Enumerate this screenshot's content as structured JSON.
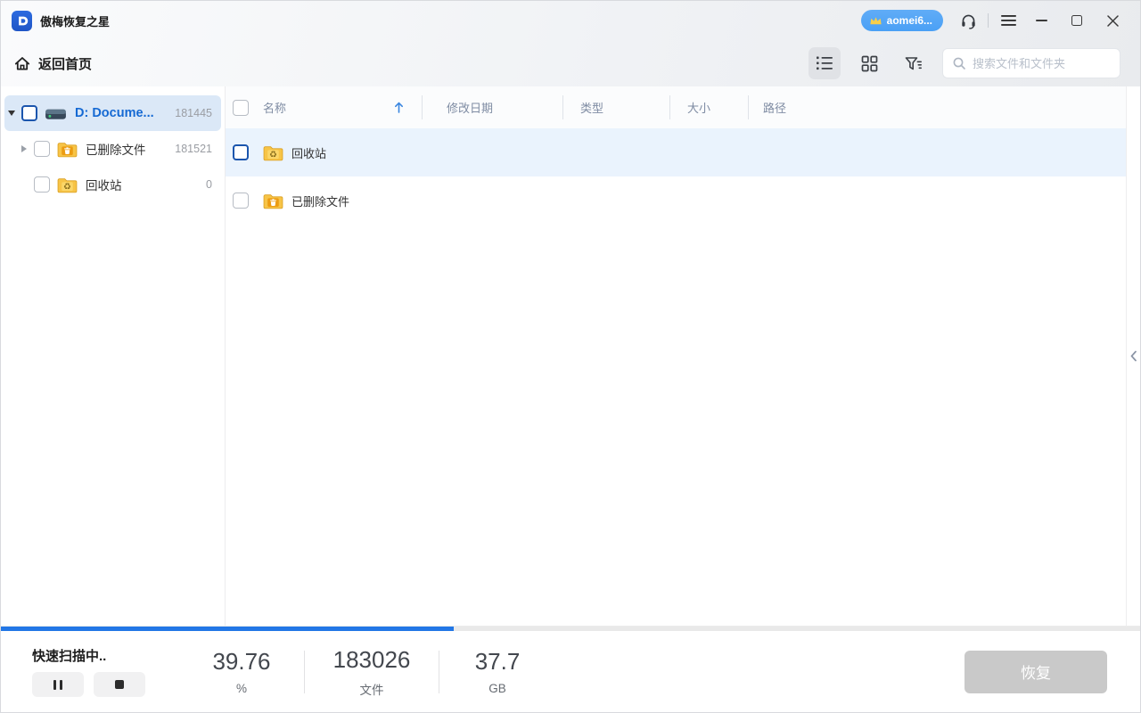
{
  "colors": {
    "accent_blue": "#2277e6",
    "link_blue": "#1569d3",
    "selection_bg": "#dbe8f7",
    "row_highlight": "#eaf3fd",
    "folder_yellow": "#f5bc3f",
    "disabled_gray": "#c9c9c9",
    "progress_track": "#e9e9e9",
    "badge_blue": "#4aa0f5",
    "header_text": "#7f8ca3"
  },
  "titlebar": {
    "app_name": "傲梅恢复之星",
    "account_badge": "aomei6..."
  },
  "toolbar": {
    "back_home": "返回首页",
    "search_placeholder": "搜索文件和文件夹"
  },
  "sidebar": {
    "items": [
      {
        "label": "D: Docume...",
        "count": "181445",
        "type": "drive",
        "selected": true,
        "expanded": true
      },
      {
        "label": "已删除文件",
        "count": "181521",
        "type": "folder-trash",
        "collapsed": true
      },
      {
        "label": "回收站",
        "count": "0",
        "type": "folder-recycle"
      }
    ]
  },
  "table": {
    "columns": [
      "名称",
      "修改日期",
      "类型",
      "大小",
      "路径"
    ],
    "sort": {
      "column": "名称",
      "direction": "ascending"
    },
    "rows": [
      {
        "name": "回收站",
        "icon": "folder-recycle",
        "highlighted": true
      },
      {
        "name": "已删除文件",
        "icon": "folder-trash",
        "highlighted": false
      }
    ]
  },
  "statusbar": {
    "status_text": "快速扫描中..",
    "progress_percent": 39.76,
    "stats": [
      {
        "value": "39.76",
        "label": "%"
      },
      {
        "value": "183026",
        "label": "文件"
      },
      {
        "value": "37.7",
        "label": "GB"
      }
    ],
    "recover_label": "恢复"
  }
}
